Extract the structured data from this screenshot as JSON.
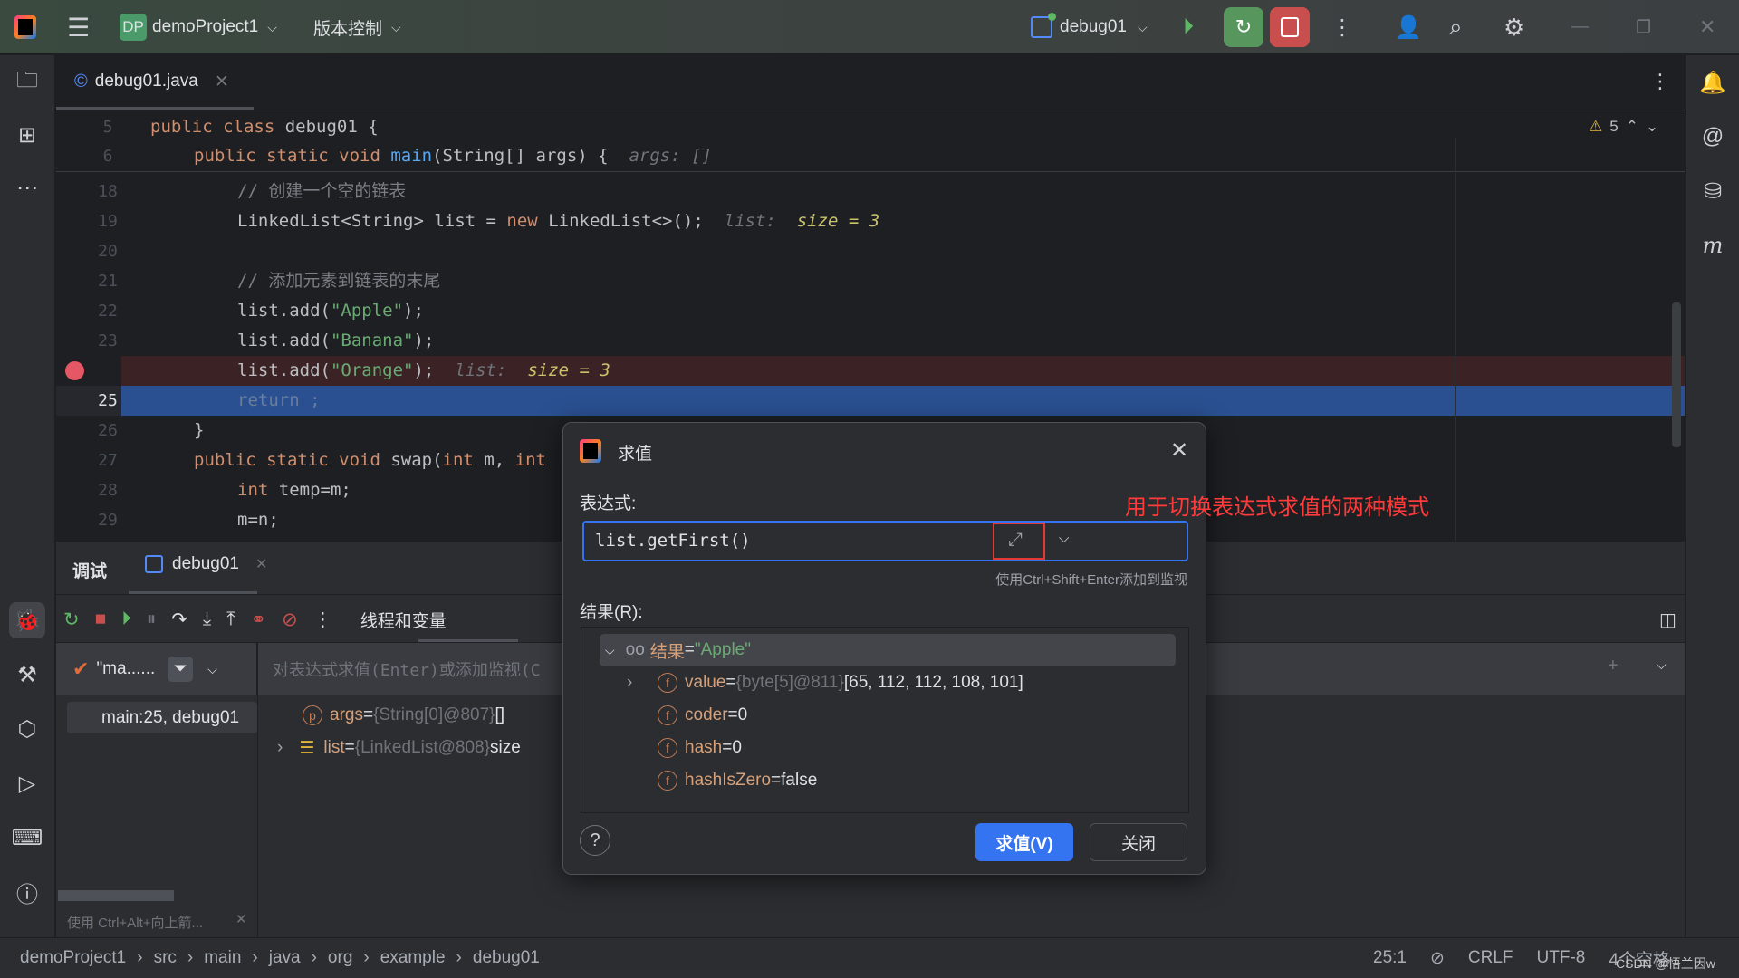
{
  "titlebar": {
    "project_badge": "DP",
    "project": "demoProject1",
    "vcs": "版本控制",
    "run_config": "debug01",
    "badge_color": "#4b9a6a",
    "debug_btn_color": "#57965c",
    "stop_btn_color": "#c94f4f"
  },
  "editor": {
    "tab": "debug01.java",
    "warnings": "5",
    "lines": [
      {
        "n": "5",
        "indent": 0,
        "t": [
          [
            "kw",
            "public class "
          ],
          [
            "id",
            "debug01 {"
          ]
        ]
      },
      {
        "n": "6",
        "indent": 1,
        "t": [
          [
            "kw",
            "public static void "
          ],
          [
            "fn",
            "main"
          ],
          [
            "id",
            "(String[] args) {"
          ],
          [
            "hint",
            "  args: []"
          ]
        ]
      },
      {
        "n": "18",
        "indent": 2,
        "t": [
          [
            "cm",
            "// 创建一个空的链表"
          ]
        ]
      },
      {
        "n": "19",
        "indent": 2,
        "t": [
          [
            "id",
            "LinkedList<String> list = "
          ],
          [
            "kw",
            "new "
          ],
          [
            "id",
            "LinkedList<>();"
          ],
          [
            "hint",
            "  list:  "
          ],
          [
            "hv",
            "size = 3"
          ]
        ]
      },
      {
        "n": "20",
        "indent": 2,
        "t": []
      },
      {
        "n": "21",
        "indent": 2,
        "t": [
          [
            "cm",
            "// 添加元素到链表的末尾"
          ]
        ]
      },
      {
        "n": "22",
        "indent": 2,
        "t": [
          [
            "id",
            "list.add("
          ],
          [
            "str",
            "\"Apple\""
          ],
          [
            "id",
            ");"
          ]
        ]
      },
      {
        "n": "23",
        "indent": 2,
        "t": [
          [
            "id",
            "list.add("
          ],
          [
            "str",
            "\"Banana\""
          ],
          [
            "id",
            ");"
          ]
        ]
      },
      {
        "n": "",
        "indent": 2,
        "t": [
          [
            "id",
            "list.add("
          ],
          [
            "str",
            "\"Orange\""
          ],
          [
            "id",
            ");"
          ],
          [
            "hint",
            "  list:  "
          ],
          [
            "hv",
            "size = 3"
          ]
        ],
        "breakpoint": true
      },
      {
        "n": "25",
        "indent": 2,
        "t": [
          [
            "ret",
            "return ;"
          ]
        ],
        "current": true
      },
      {
        "n": "26",
        "indent": 1,
        "t": [
          [
            "id",
            "}"
          ]
        ]
      },
      {
        "n": "27",
        "indent": 1,
        "t": [
          [
            "kw",
            "public static void "
          ],
          [
            "id",
            "swap("
          ],
          [
            "kw",
            "int "
          ],
          [
            "id",
            "m, "
          ],
          [
            "kw",
            "int"
          ]
        ]
      },
      {
        "n": "28",
        "indent": 2,
        "t": [
          [
            "kw",
            "int "
          ],
          [
            "id",
            "temp=m;"
          ]
        ]
      },
      {
        "n": "29",
        "indent": 2,
        "t": [
          [
            "id",
            "m=n;"
          ]
        ]
      }
    ]
  },
  "debug": {
    "tab_title": "调试",
    "session_tab": "debug01",
    "threads_tab": "线程和变量",
    "thread": "\"ma......",
    "frame": "main:25, debug01",
    "eval_placeholder": "对表达式求值(Enter)或添加监视(C",
    "vars": [
      {
        "name": "args",
        "eq": " = ",
        "ref": "{String[0]@807}",
        "val": " []"
      },
      {
        "name": "list",
        "eq": " = ",
        "ref": "{LinkedList@808}",
        "val": "  size"
      }
    ],
    "tip": "使用 Ctrl+Alt+向上箭..."
  },
  "dialog": {
    "title": "求值",
    "expr_label": "表达式:",
    "expression": "list.getFirst()",
    "hint": "使用Ctrl+Shift+Enter添加到监视",
    "result_label": "结果(R):",
    "root": {
      "name": "结果",
      "eq": " = ",
      "value": "\"Apple\""
    },
    "children": [
      {
        "name": "value",
        "eq": " = ",
        "ref": "{byte[5]@811}",
        "val": " [65, 112, 112, 108, 101]",
        "expandable": true
      },
      {
        "name": "coder",
        "eq": " = ",
        "val": "0"
      },
      {
        "name": "hash",
        "eq": " = ",
        "val": "0"
      },
      {
        "name": "hashIsZero",
        "eq": " = ",
        "val": "false"
      }
    ],
    "evaluate_btn": "求值(V)",
    "close_btn": "关闭",
    "help": "?",
    "accent": "#3574f0"
  },
  "annotation": {
    "text": "用于切换表达式求值的两种模式",
    "color": "#ff3b3b"
  },
  "statusbar": {
    "crumbs": [
      "demoProject1",
      "src",
      "main",
      "java",
      "org",
      "example",
      "debug01"
    ],
    "position": "25:1",
    "line_sep": "CRLF",
    "encoding": "UTF-8",
    "indent": "4个空格",
    "watermark": "CSDN @悟兰因w"
  }
}
